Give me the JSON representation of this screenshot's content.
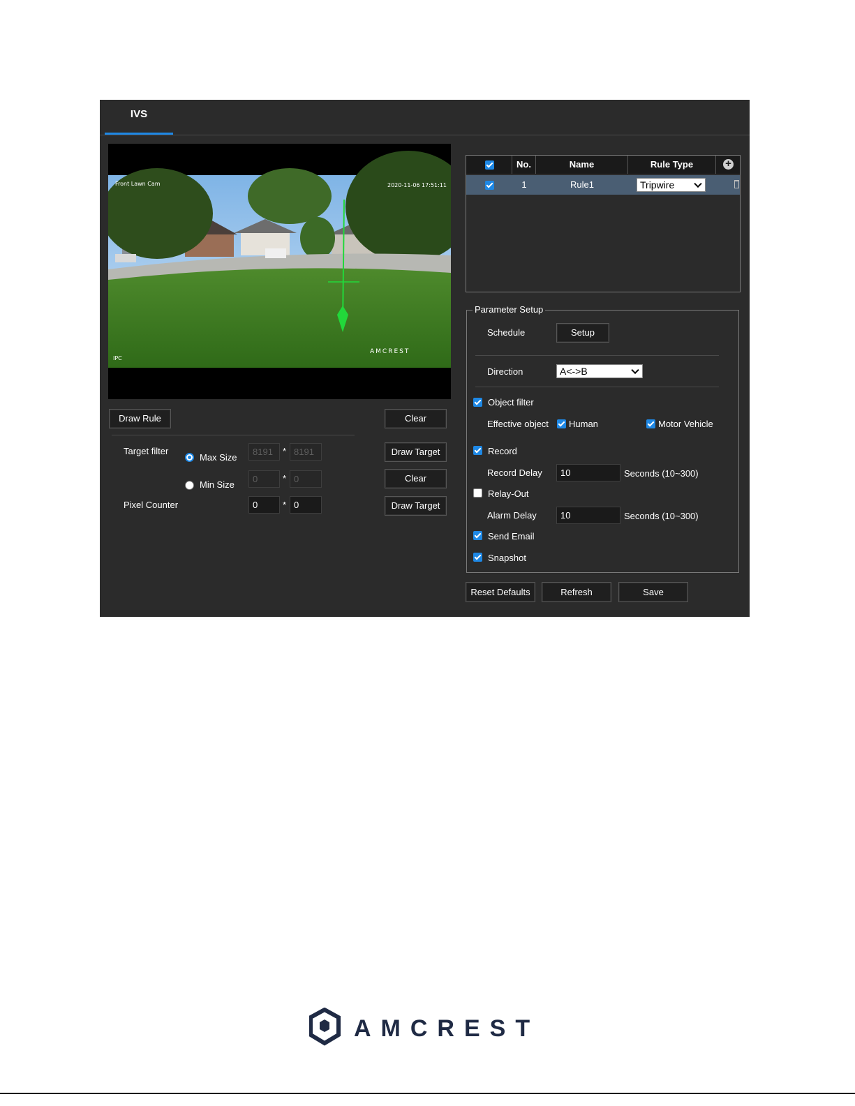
{
  "tab": {
    "label": "IVS"
  },
  "video": {
    "overlay_top_left": "Front Lawn Cam",
    "overlay_top_right": "2020-11-06 17:51:11",
    "overlay_bottom_left": "IPC",
    "watermark": "AMCREST"
  },
  "left": {
    "draw_rule": "Draw Rule",
    "clear_1": "Clear",
    "target_filter": "Target filter",
    "max_size": "Max Size",
    "min_size": "Min Size",
    "pixel_counter": "Pixel Counter",
    "max_w": "8191",
    "max_h": "8191",
    "min_w": "0",
    "min_h": "0",
    "pix_w": "0",
    "pix_h": "0",
    "star": "*",
    "draw_target_1": "Draw Target",
    "clear_2": "Clear",
    "draw_target_2": "Draw Target",
    "selected_filter": "Max Size"
  },
  "rules_table": {
    "headers": {
      "no": "No.",
      "name": "Name",
      "rule_type": "Rule Type"
    },
    "rows": [
      {
        "checked": true,
        "no": "1",
        "name": "Rule1",
        "rule_type": "Tripwire"
      }
    ]
  },
  "params": {
    "legend": "Parameter Setup",
    "schedule": "Schedule",
    "setup": "Setup",
    "direction": "Direction",
    "direction_value": "A<->B",
    "object_filter": "Object filter",
    "effective_object": "Effective object",
    "human": "Human",
    "motor_vehicle": "Motor Vehicle",
    "record": "Record",
    "record_delay": "Record Delay",
    "record_delay_value": "10",
    "record_delay_unit": "Seconds (10~300)",
    "relay_out": "Relay-Out",
    "alarm_delay": "Alarm Delay",
    "alarm_delay_value": "10",
    "alarm_delay_unit": "Seconds (10~300)",
    "send_email": "Send Email",
    "snapshot": "Snapshot"
  },
  "footer_buttons": {
    "reset": "Reset Defaults",
    "refresh": "Refresh",
    "save": "Save"
  },
  "brand": {
    "name": "AMCREST"
  },
  "colors": {
    "panel_bg": "#2b2b2b",
    "accent": "#1e88e5",
    "selected_row": "#4a5e73"
  }
}
